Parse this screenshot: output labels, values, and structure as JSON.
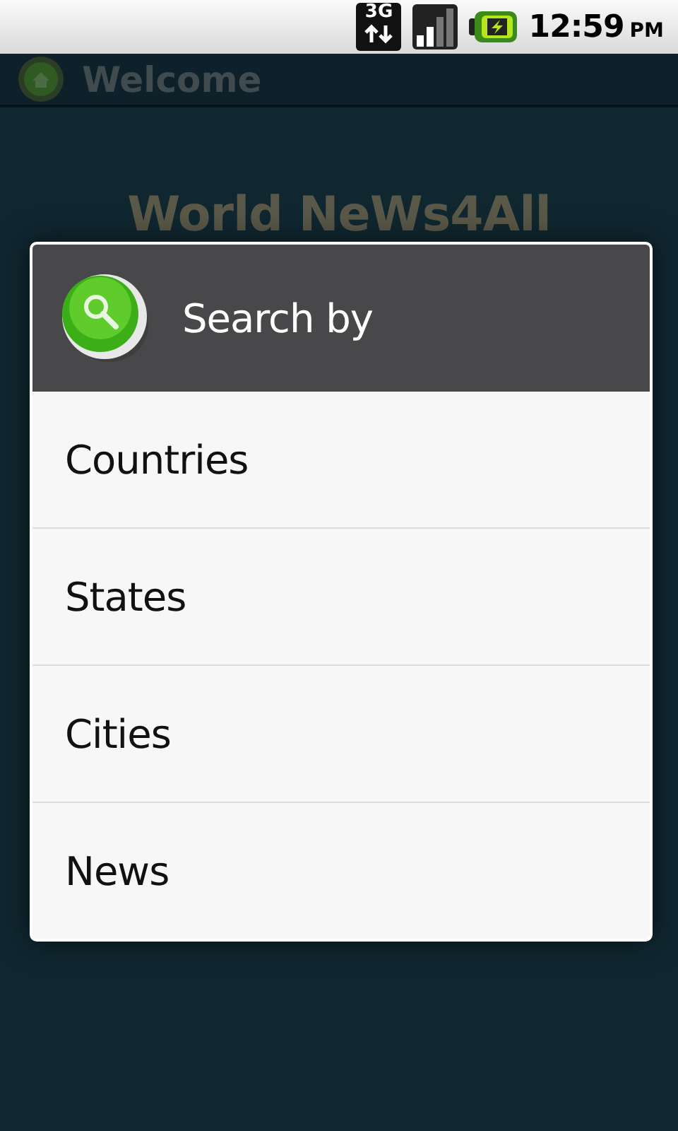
{
  "status_bar": {
    "network": "3G",
    "time": "12:59",
    "period": "PM"
  },
  "title_bar": {
    "title": "Welcome"
  },
  "background": {
    "heading": "World NeWs4All"
  },
  "dialog": {
    "title": "Search by",
    "items": [
      {
        "label": "Countries"
      },
      {
        "label": "States"
      },
      {
        "label": "Cities"
      },
      {
        "label": "News"
      }
    ]
  }
}
